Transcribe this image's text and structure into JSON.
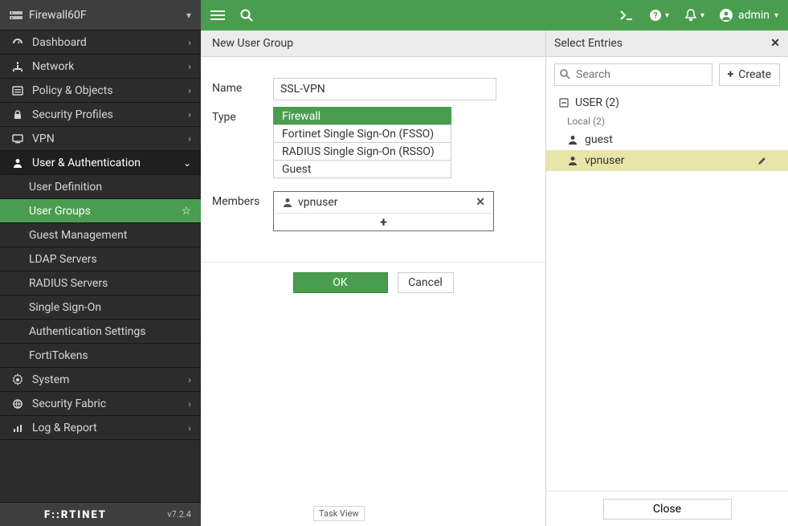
{
  "device": {
    "name": "Firewall60F"
  },
  "footer": {
    "brand": "F • RTINET",
    "version": "v7.2.4"
  },
  "topbar": {
    "admin_label": "admin"
  },
  "nav": {
    "items": [
      {
        "label": "Dashboard"
      },
      {
        "label": "Network"
      },
      {
        "label": "Policy & Objects"
      },
      {
        "label": "Security Profiles"
      },
      {
        "label": "VPN"
      },
      {
        "label": "User & Authentication"
      },
      {
        "label": "System"
      },
      {
        "label": "Security Fabric"
      },
      {
        "label": "Log & Report"
      }
    ],
    "sub": [
      {
        "label": "User Definition"
      },
      {
        "label": "User Groups"
      },
      {
        "label": "Guest Management"
      },
      {
        "label": "LDAP Servers"
      },
      {
        "label": "RADIUS Servers"
      },
      {
        "label": "Single Sign-On"
      },
      {
        "label": "Authentication Settings"
      },
      {
        "label": "FortiTokens"
      }
    ]
  },
  "page": {
    "title": "New User Group"
  },
  "form": {
    "name_label": "Name",
    "name_value": "SSL-VPN",
    "type_label": "Type",
    "type_options": [
      "Firewall",
      "Fortinet Single Sign-On (FSSO)",
      "RADIUS Single Sign-On (RSSO)",
      "Guest"
    ],
    "members_label": "Members",
    "members": [
      {
        "name": "vpnuser"
      }
    ],
    "add_label": "+",
    "ok_label": "OK",
    "cancel_label": "Cancel"
  },
  "taskview": {
    "label": "Task View"
  },
  "select_panel": {
    "title": "Select Entries",
    "search_placeholder": "Search",
    "create_label": "Create",
    "group_label": "USER (2)",
    "local_label": "Local (2)",
    "entries": [
      {
        "name": "guest",
        "selected": false
      },
      {
        "name": "vpnuser",
        "selected": true
      }
    ],
    "close_label": "Close"
  }
}
